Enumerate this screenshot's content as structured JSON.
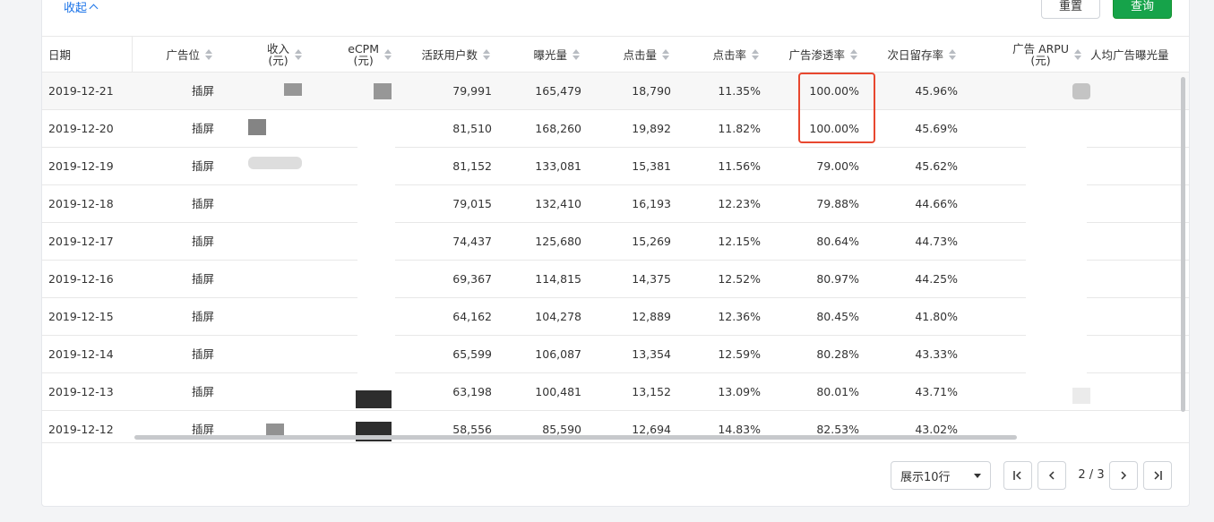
{
  "toolbar": {
    "collapse_label": "收起",
    "reset_label": "重置",
    "query_label": "查询"
  },
  "table": {
    "headers": {
      "date": "日期",
      "ad_slot": "广告位",
      "revenue": "收入",
      "revenue_unit": "(元)",
      "ecpm": "eCPM",
      "ecpm_unit": "(元)",
      "active_users": "活跃用户数",
      "impressions": "曝光量",
      "clicks": "点击量",
      "ctr": "点击率",
      "penetration": "广告渗透率",
      "retention": "次日留存率",
      "arpu": "广告 ARPU",
      "arpu_unit": "(元)",
      "per_user_imp": "人均广告曝光量"
    },
    "rows": [
      {
        "date": "2019-12-21",
        "slot": "插屏",
        "active": "79,991",
        "imp": "165,479",
        "clicks": "18,790",
        "ctr": "11.35%",
        "pen": "100.00%",
        "ret": "45.96%"
      },
      {
        "date": "2019-12-20",
        "slot": "插屏",
        "active": "81,510",
        "imp": "168,260",
        "clicks": "19,892",
        "ctr": "11.82%",
        "pen": "100.00%",
        "ret": "45.69%"
      },
      {
        "date": "2019-12-19",
        "slot": "插屏",
        "active": "81,152",
        "imp": "133,081",
        "clicks": "15,381",
        "ctr": "11.56%",
        "pen": "79.00%",
        "ret": "45.62%"
      },
      {
        "date": "2019-12-18",
        "slot": "插屏",
        "active": "79,015",
        "imp": "132,410",
        "clicks": "16,193",
        "ctr": "12.23%",
        "pen": "79.88%",
        "ret": "44.66%"
      },
      {
        "date": "2019-12-17",
        "slot": "插屏",
        "active": "74,437",
        "imp": "125,680",
        "clicks": "15,269",
        "ctr": "12.15%",
        "pen": "80.64%",
        "ret": "44.73%"
      },
      {
        "date": "2019-12-16",
        "slot": "插屏",
        "active": "69,367",
        "imp": "114,815",
        "clicks": "14,375",
        "ctr": "12.52%",
        "pen": "80.97%",
        "ret": "44.25%"
      },
      {
        "date": "2019-12-15",
        "slot": "插屏",
        "active": "64,162",
        "imp": "104,278",
        "clicks": "12,889",
        "ctr": "12.36%",
        "pen": "80.45%",
        "ret": "41.80%"
      },
      {
        "date": "2019-12-14",
        "slot": "插屏",
        "active": "65,599",
        "imp": "106,087",
        "clicks": "13,354",
        "ctr": "12.59%",
        "pen": "80.28%",
        "ret": "43.33%"
      },
      {
        "date": "2019-12-13",
        "slot": "插屏",
        "active": "63,198",
        "imp": "100,481",
        "clicks": "13,152",
        "ctr": "13.09%",
        "pen": "80.01%",
        "ret": "43.71%"
      },
      {
        "date": "2019-12-12",
        "slot": "插屏",
        "active": "58,556",
        "imp": "85,590",
        "clicks": "12,694",
        "ctr": "14.83%",
        "pen": "82.53%",
        "ret": "43.02%"
      }
    ]
  },
  "pagination": {
    "page_size_label": "展示10行",
    "page_info": "2 / 3"
  },
  "colors": {
    "primary_green": "#16a34a",
    "link_blue": "#1a73e8",
    "highlight_red": "#e8472f"
  }
}
